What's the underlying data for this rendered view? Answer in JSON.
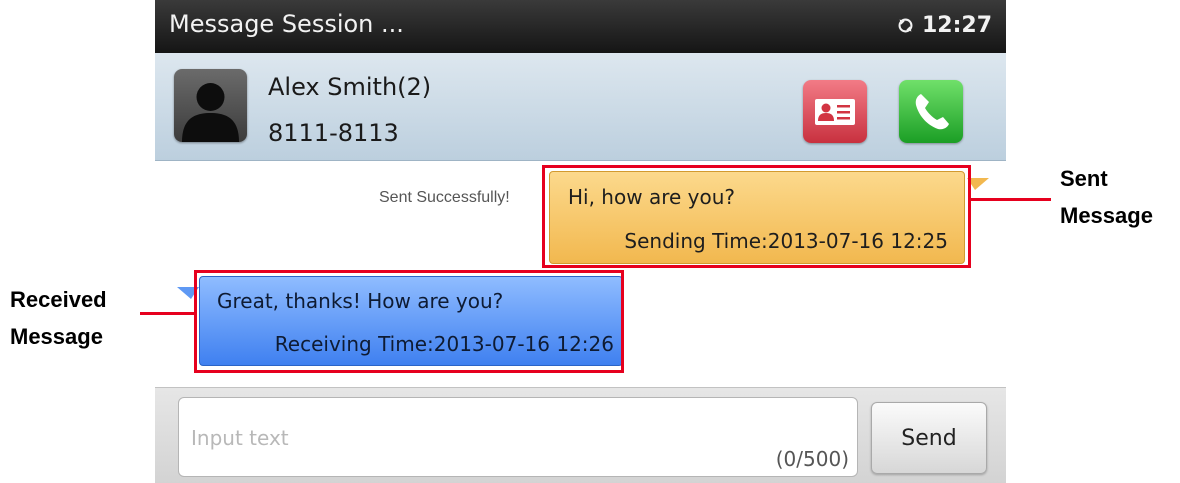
{
  "status_bar": {
    "title": "Message Session ...",
    "time": "12:27"
  },
  "contact": {
    "name": "Alex Smith(2)",
    "number": "8111-8113"
  },
  "conversation": {
    "sent": {
      "status": "Sent Successfully!",
      "text": "Hi, how are you?",
      "time_label": "Sending Time:2013-07-16 12:25"
    },
    "received": {
      "text": "Great, thanks! How are you?",
      "time_label": "Receiving Time:2013-07-16 12:26"
    }
  },
  "input": {
    "placeholder": "Input text",
    "counter": "(0/500)",
    "send_label": "Send"
  },
  "annotations": {
    "sent": {
      "line1": "Sent",
      "line2": "Message"
    },
    "received": {
      "line1": "Received",
      "line2": "Message"
    }
  },
  "colors": {
    "annotation": "#e6001e",
    "sent_bubble": "#f2b84f",
    "received_bubble": "#3f80f0",
    "call_green": "#1b9e25",
    "card_red": "#c8313f"
  },
  "icons": [
    "sync-icon",
    "avatar-silhouette-icon",
    "contact-card-icon",
    "phone-icon"
  ]
}
